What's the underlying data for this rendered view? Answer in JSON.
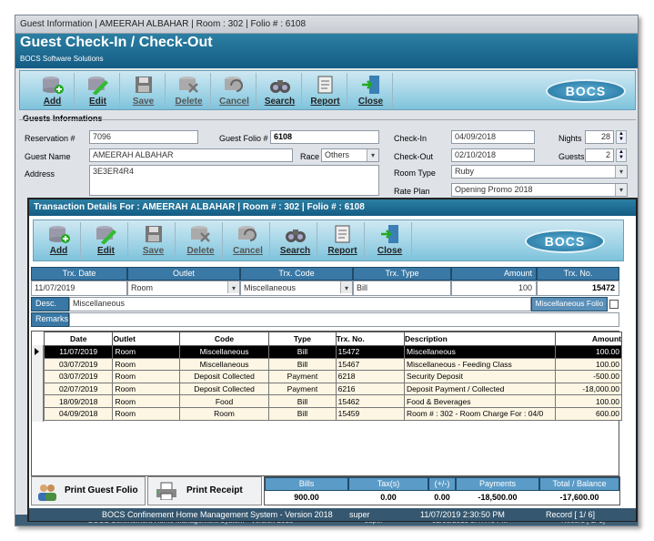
{
  "window": {
    "titlebar": "Guest Information  |  AMEERAH ALBAHAR  |  Room : 302  |  Folio # : 6108",
    "header_title": "Guest Check-In / Check-Out",
    "header_subtitle": "BOCS Software Solutions"
  },
  "toolbar": {
    "buttons": [
      {
        "label": "Add",
        "icon": "add-database-icon"
      },
      {
        "label": "Edit",
        "icon": "edit-pencil-icon"
      },
      {
        "label": "Save",
        "icon": "save-floppy-icon"
      },
      {
        "label": "Delete",
        "icon": "delete-x-icon"
      },
      {
        "label": "Cancel",
        "icon": "cancel-undo-icon"
      },
      {
        "label": "Search",
        "icon": "binoculars-icon"
      },
      {
        "label": "Report",
        "icon": "report-scroll-icon"
      },
      {
        "label": "Close",
        "icon": "exit-door-icon"
      }
    ],
    "logo": "BOCS"
  },
  "guest": {
    "section_title": "Guests Informations",
    "reservation_label": "Reservation #",
    "reservation_value": "7096",
    "guest_folio_label": "Guest Folio #",
    "guest_folio_value": "6108",
    "guest_name_label": "Guest Name",
    "guest_name_value": "AMEERAH ALBAHAR",
    "race_label": "Race",
    "race_value": "Others",
    "address_label": "Address",
    "address_value": "3E3ER4R4",
    "checkin_label": "Check-In",
    "checkin_value": "04/09/2018",
    "checkout_label": "Check-Out",
    "checkout_value": "02/10/2018",
    "nights_label": "Nights",
    "nights_value": "28",
    "guests_label": "Guests",
    "guests_value": "2",
    "room_type_label": "Room Type",
    "room_type_value": "Ruby",
    "rate_plan_label": "Rate Plan",
    "rate_plan_value": "Opening Promo 2018"
  },
  "trx": {
    "header": "Transaction Details For : AMEERAH ALBAHAR   |   Room # : 302   |   Folio # : 6108",
    "form": {
      "columns": [
        "Trx. Date",
        "Outlet",
        "Trx. Code",
        "Trx. Type",
        "Amount",
        "Trx. No."
      ],
      "values": [
        "11/07/2019",
        "Room",
        "Miscellaneous",
        "Bill",
        "100",
        "15472"
      ],
      "desc_label": "Desc.",
      "desc_value": "Miscellaneous",
      "remarks_label": "Remarks",
      "misc_folio_label": "Miscellaneous Folio"
    },
    "grid": {
      "headers": [
        "Date",
        "Outlet",
        "Code",
        "Type",
        "Trx. No.",
        "Description",
        "Amount"
      ],
      "rows": [
        [
          "11/07/2019",
          "Room",
          "Miscellaneous",
          "Bill",
          "15472",
          "Miscellaneous",
          "100.00"
        ],
        [
          "03/07/2019",
          "Room",
          "Miscellaneous",
          "Bill",
          "15467",
          "Miscellaneous - Feeding Class",
          "100.00"
        ],
        [
          "03/07/2019",
          "Room",
          "Deposit Collected",
          "Payment",
          "6218",
          "Security Deposit",
          "-500.00"
        ],
        [
          "02/07/2019",
          "Room",
          "Deposit Collected",
          "Payment",
          "6216",
          "Deposit Payment / Collected",
          "-18,000.00"
        ],
        [
          "18/09/2018",
          "Room",
          "Food",
          "Bill",
          "15462",
          "Food & Beverages",
          "100.00"
        ],
        [
          "04/09/2018",
          "Room",
          "Room",
          "Bill",
          "15459",
          "Room # : 302 - Room Charge For : 04/0",
          "600.00"
        ]
      ]
    },
    "print_guest_folio": "Print Guest Folio",
    "print_receipt": "Print Receipt",
    "summary": {
      "headers": [
        "Bills",
        "Tax(s)",
        "(+/-)",
        "Payments",
        "Total / Balance"
      ],
      "values": [
        "900.00",
        "0.00",
        "0.00",
        "-18,500.00",
        "-17,600.00"
      ]
    },
    "status": {
      "system": "BOCS Confinement Home Management System - Version 2018",
      "user": "super",
      "datetime": "11/07/2019 2:30:50 PM",
      "record": "Record  [ 1/ 6]"
    }
  },
  "background_status": {
    "system": "BOCS Confinement Home Management System - Version 2018",
    "user": "super",
    "datetime": "02/08/2019 3:47:46 PM",
    "record": "Record  [ 1/ 1]"
  },
  "colors": {
    "header_blue": "#1d6f9a",
    "selected_row": "#000000",
    "row_cream": "#fdf6e4"
  }
}
